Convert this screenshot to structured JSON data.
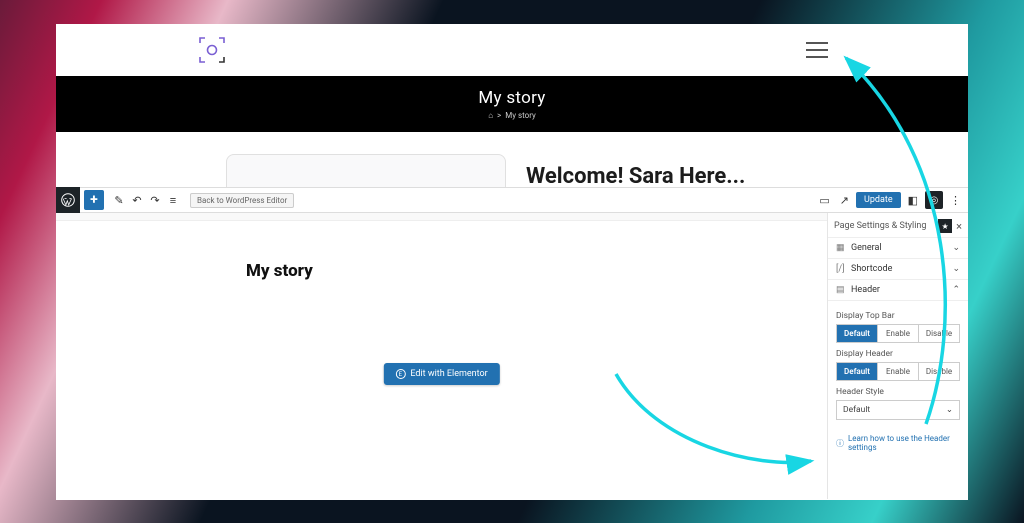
{
  "site": {
    "title": "My story",
    "breadcrumb_current": "My story",
    "welcome": "Welcome! Sara Here..."
  },
  "wp": {
    "back_label": "Back to WordPress Editor",
    "update_label": "Update"
  },
  "canvas": {
    "title": "My story",
    "elementor_label": "Edit with Elementor"
  },
  "panel": {
    "title": "Page Settings & Styling",
    "sections": {
      "general": "General",
      "shortcode": "Shortcode",
      "header": "Header"
    },
    "header_section": {
      "display_top_bar_label": "Display Top Bar",
      "display_header_label": "Display Header",
      "header_style_label": "Header Style",
      "options": {
        "default": "Default",
        "enable": "Enable",
        "disable": "Disable"
      },
      "header_style_value": "Default"
    },
    "help_text": "Learn how to use the Header settings"
  }
}
